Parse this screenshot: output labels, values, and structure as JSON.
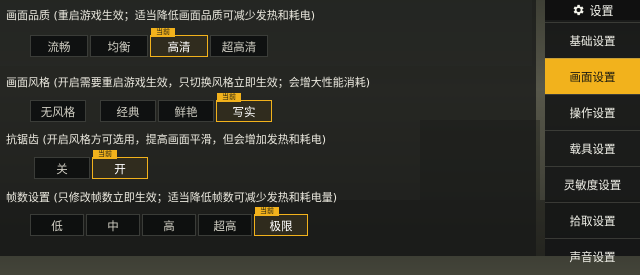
{
  "badge_current": "当前",
  "colors": {
    "accent": "#f2b21c"
  },
  "sections": [
    {
      "title": "画面品质 (重启游戏生效；适当降低画面品质可减少发热和耗电)",
      "options": [
        "流畅",
        "均衡",
        "高清",
        "超高清"
      ],
      "selected": "高清"
    },
    {
      "title": "画面风格 (开启需要重启游戏生效，只切换风格立即生效；会增大性能消耗)",
      "options": [
        "无风格",
        "经典",
        "鲜艳",
        "写实"
      ],
      "selected": "写实"
    },
    {
      "title": "抗锯齿 (开启风格方可选用，提高画面平滑，但会增加发热和耗电)",
      "options": [
        "关",
        "开"
      ],
      "selected": "开"
    },
    {
      "title": "帧数设置 (只修改帧数立即生效；适当降低帧数可减少发热和耗电量)",
      "options": [
        "低",
        "中",
        "高",
        "超高",
        "极限"
      ],
      "selected": "极限"
    }
  ],
  "sidebar": {
    "header_label": "设置",
    "header_icon": "gear-icon",
    "items": [
      {
        "label": "基础设置"
      },
      {
        "label": "画面设置",
        "active": true
      },
      {
        "label": "操作设置"
      },
      {
        "label": "载具设置"
      },
      {
        "label": "灵敏度设置"
      },
      {
        "label": "拾取设置"
      },
      {
        "label": "声音设置"
      }
    ]
  }
}
